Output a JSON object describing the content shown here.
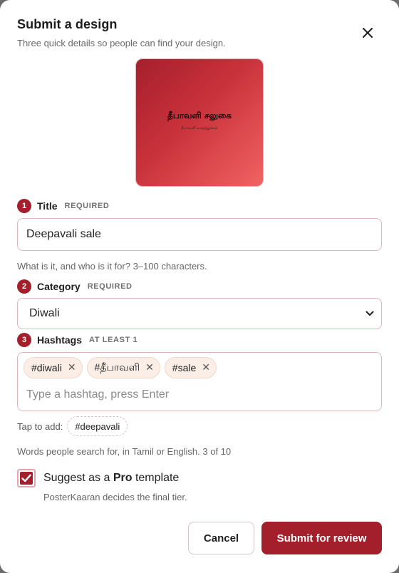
{
  "dialog": {
    "title": "Submit a design",
    "subtitle": "Three quick details so people can find your design."
  },
  "preview": {
    "title": "தீபாவளி சலுகை",
    "subtitle": "தீபாவளி வாழ்த்துக்கள்",
    "colors": {
      "start": "#a51f2c",
      "end": "#f16363"
    }
  },
  "fields": {
    "title": {
      "step": "1",
      "label": "Title",
      "tag": "REQUIRED",
      "value": "Deepavali sale",
      "hint": "What is it, and who is it for? 3–100 characters."
    },
    "category": {
      "step": "2",
      "label": "Category",
      "tag": "REQUIRED",
      "value": "Diwali"
    },
    "hashtags": {
      "step": "3",
      "label": "Hashtags",
      "tag": "AT LEAST 1",
      "chips": [
        "#diwali",
        "#தீபாவளி",
        "#sale"
      ],
      "placeholder": "Type a hashtag, press Enter",
      "suggest_label": "Tap to add:",
      "suggestions": [
        "#deepavali"
      ],
      "hint": "Words people search for, in Tamil or English. 3 of 10"
    }
  },
  "pro": {
    "checked": true,
    "label_prefix": "Suggest as a ",
    "label_bold": "Pro",
    "label_suffix": " template",
    "note": "PosterKaaran decides the final tier."
  },
  "actions": {
    "cancel": "Cancel",
    "submit": "Submit for review"
  },
  "colors": {
    "accent": "#a31f2b",
    "field_border": "#dfb7bd",
    "chip_bg": "#fbeee7"
  },
  "icons": {
    "close": "close-icon",
    "chevron": "chevron-down-icon",
    "remove": "remove-icon",
    "check": "check-icon"
  }
}
